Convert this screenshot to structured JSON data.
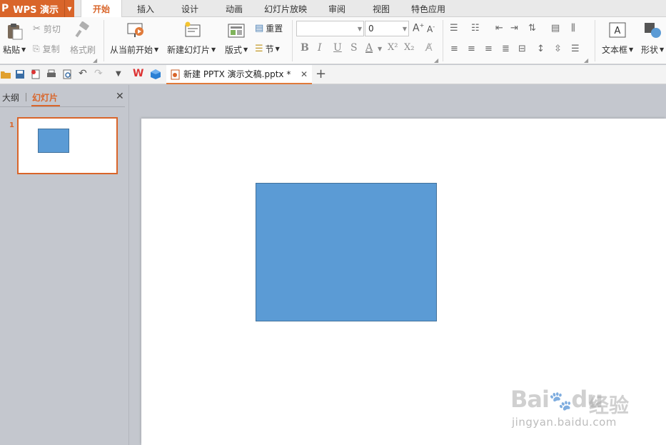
{
  "app": {
    "name": "WPS 演示",
    "logo_letter": "P"
  },
  "menu": {
    "tabs": [
      "开始",
      "插入",
      "设计",
      "动画",
      "幻灯片放映",
      "审阅",
      "视图",
      "特色应用"
    ],
    "active": "开始"
  },
  "ribbon": {
    "clipboard": {
      "paste": "粘贴",
      "cut": "剪切",
      "copy": "复制",
      "format_painter": "格式刷"
    },
    "slides": {
      "from_current": "从当前开始",
      "new_slide": "新建幻灯片",
      "layout": "版式",
      "reset": "重置",
      "section": "节"
    },
    "font": {
      "name_value": "",
      "size_value": "0"
    },
    "format_buttons": {
      "bold": "B",
      "italic": "I",
      "underline": "U",
      "shadow": "S",
      "font_color": "A",
      "superscript": "X²",
      "subscript": "X₂"
    },
    "insert": {
      "textbox": "文本框",
      "shape": "形状"
    }
  },
  "document": {
    "tab_title": "新建 PPTX 演示文稿.pptx *"
  },
  "panel": {
    "tab_outline": "大纲",
    "tab_slides": "幻灯片",
    "active": "幻灯片"
  },
  "slides": [
    {
      "number": "1"
    }
  ],
  "colors": {
    "accent": "#d9652a",
    "shape_fill": "#5b9bd5",
    "shape_border": "#41719c"
  },
  "watermark": {
    "brand": "Bai",
    "brand2": "du",
    "cn": "经验",
    "url": "jingyan.baidu.com"
  }
}
